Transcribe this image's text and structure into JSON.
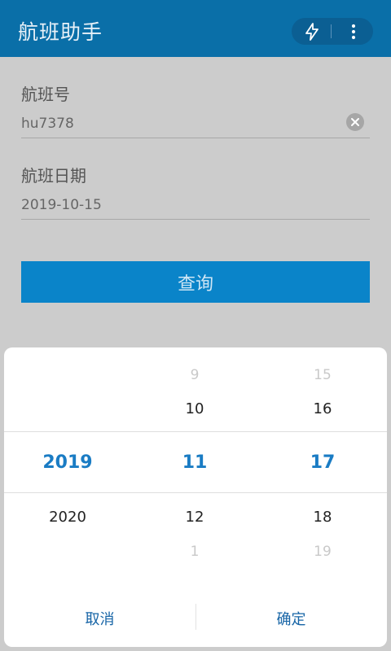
{
  "app": {
    "title": "航班助手"
  },
  "header_icons": {
    "left": "flash-icon",
    "right": "more-vert-icon"
  },
  "form": {
    "flight_no_label": "航班号",
    "flight_no_value": "hu7378",
    "flight_date_label": "航班日期",
    "flight_date_value": "2019-10-15",
    "query_label": "查询"
  },
  "picker": {
    "year": {
      "selected": "2019",
      "after": "2020"
    },
    "month": {
      "prev2": "9",
      "prev1": "10",
      "selected": "11",
      "next1": "12",
      "next2": "1"
    },
    "day": {
      "prev2": "15",
      "prev1": "16",
      "selected": "17",
      "next1": "18",
      "next2": "19"
    },
    "cancel_label": "取消",
    "ok_label": "确定"
  },
  "colors": {
    "header_bg": "#0a6fa8",
    "accent": "#0a84c9",
    "selected_text": "#1a7cc4",
    "dialog_button_text": "#1664a6"
  }
}
